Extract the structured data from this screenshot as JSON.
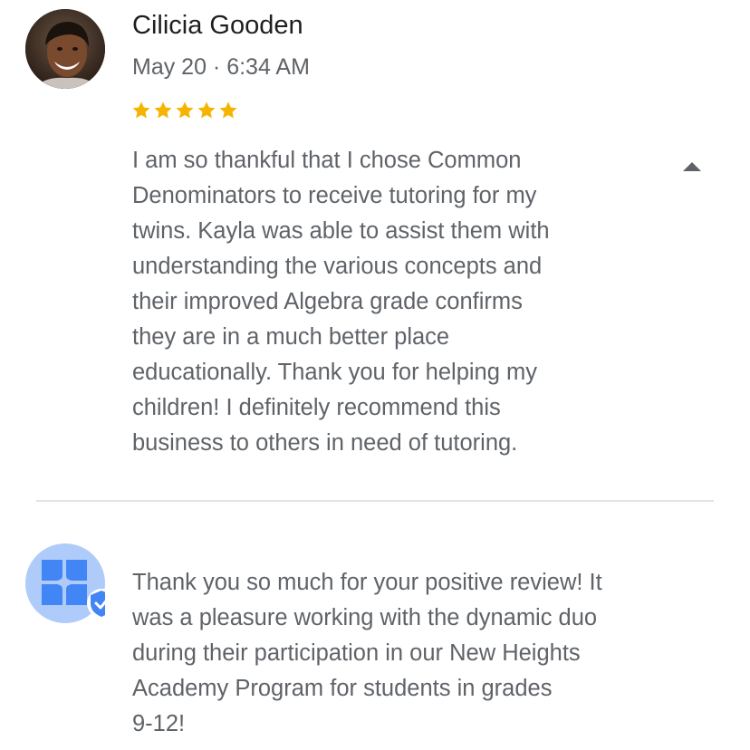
{
  "review": {
    "reviewer_name": "Cilicia Gooden",
    "date": "May 20 · 6:34 AM",
    "rating": 5,
    "rating_max": 5,
    "star_color": "#f4b400",
    "body_lines": [
      "I am so thankful that I chose Common",
      "Denominators to receive tutoring for my",
      "twins. Kayla was able to assist them with",
      "understanding the various concepts and",
      "their improved Algebra grade confirms",
      "they are in a much better place",
      "educationally. Thank you for helping my",
      "children! I definitely recommend this",
      "business to others in need of tutoring."
    ],
    "collapse_icon": "chevron-up-icon"
  },
  "owner_reply": {
    "avatar_icon": "business-logo-icon",
    "verified_icon": "verified-shield-icon",
    "accent_color": "#4285f4",
    "body_lines": [
      "Thank you so much for your positive review! It",
      "was a pleasure working with the dynamic duo",
      "during their participation in our New Heights",
      "Academy Program for students in grades",
      "9-12!"
    ]
  }
}
